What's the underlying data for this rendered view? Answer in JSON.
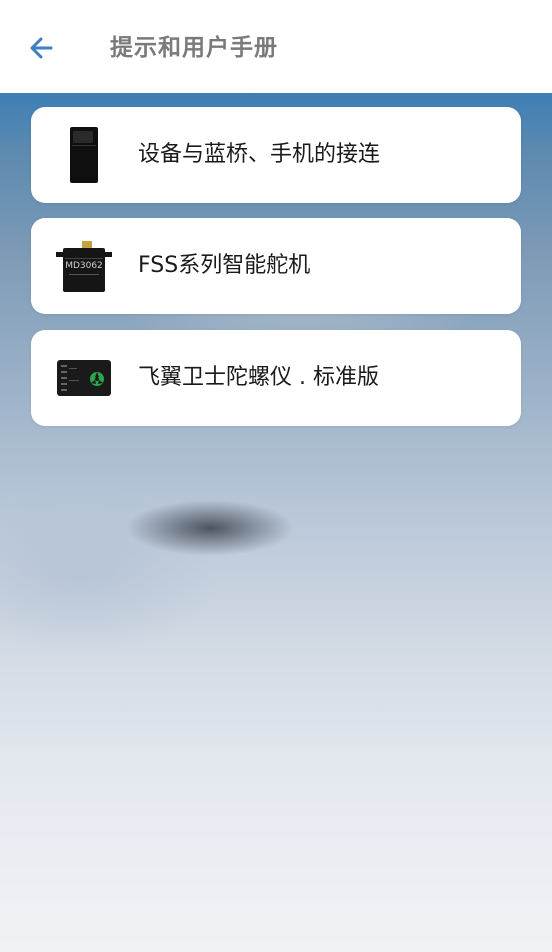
{
  "header": {
    "back_icon": "arrow-left-icon",
    "title": "提示和用户手册",
    "accent_color": "#3d7fc0"
  },
  "manuals": [
    {
      "label": "设备与蓝桥、手机的接连",
      "icon": "bluetooth-bridge-device-image"
    },
    {
      "label": "FSS系列智能舵机",
      "icon": "servo-image",
      "device_text": "MD3062"
    },
    {
      "label": "飞翼卫士陀螺仪 . 标准版",
      "icon": "gyroscope-board-image"
    }
  ]
}
